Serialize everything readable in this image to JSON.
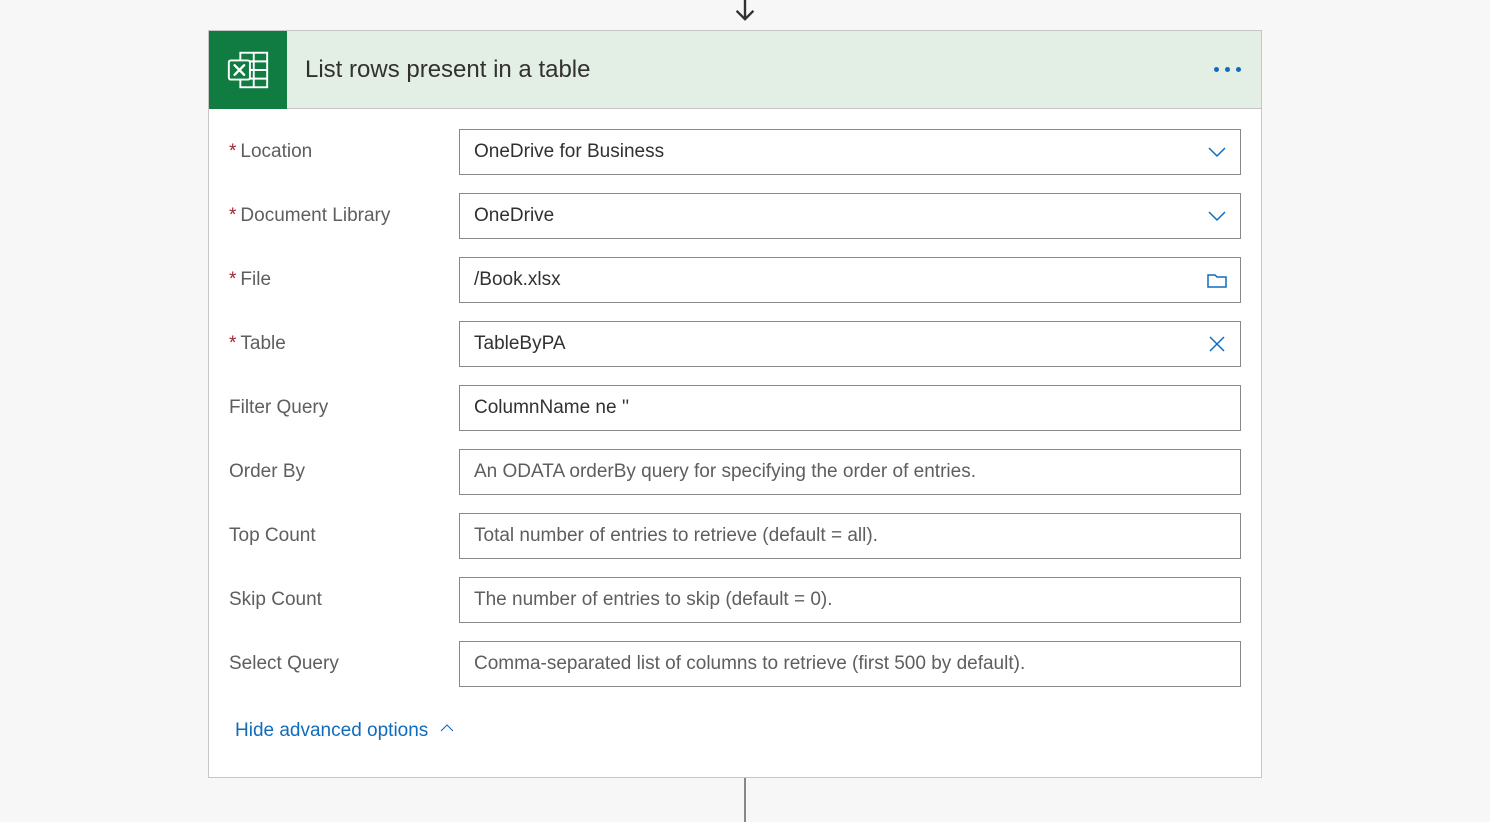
{
  "header": {
    "title": "List rows present in a table"
  },
  "fields": {
    "location": {
      "label": "Location",
      "value": "OneDrive for Business"
    },
    "documentLibrary": {
      "label": "Document Library",
      "value": "OneDrive"
    },
    "file": {
      "label": "File",
      "value": "/Book.xlsx"
    },
    "table": {
      "label": "Table",
      "value": "TableByPA"
    },
    "filterQuery": {
      "label": "Filter Query",
      "value": "ColumnName ne ''"
    },
    "orderBy": {
      "label": "Order By",
      "placeholder": "An ODATA orderBy query for specifying the order of entries."
    },
    "topCount": {
      "label": "Top Count",
      "placeholder": "Total number of entries to retrieve (default = all)."
    },
    "skipCount": {
      "label": "Skip Count",
      "placeholder": "The number of entries to skip (default = 0)."
    },
    "selectQuery": {
      "label": "Select Query",
      "placeholder": "Comma-separated list of columns to retrieve (first 500 by default)."
    }
  },
  "advancedToggle": {
    "label": "Hide advanced options"
  }
}
